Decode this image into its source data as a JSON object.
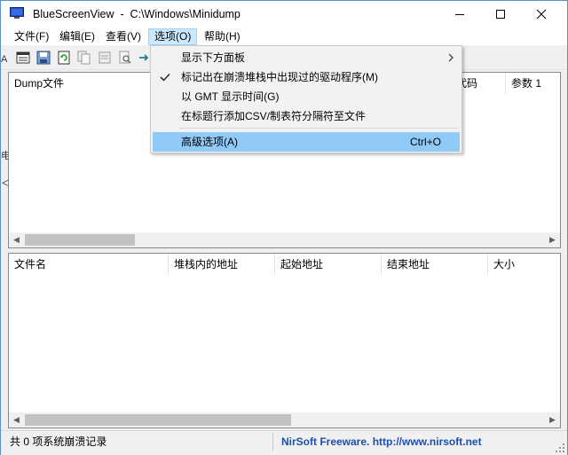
{
  "window": {
    "title": "BlueScreenView  -  C:\\Windows\\Minidump",
    "minimize_glyph": "─",
    "maximize_glyph": "☐",
    "close_glyph": "✕"
  },
  "menubar": {
    "items": [
      {
        "label": "文件(F)"
      },
      {
        "label": "编辑(E)"
      },
      {
        "label": "查看(V)"
      },
      {
        "label": "选项(O)"
      },
      {
        "label": "帮助(H)"
      }
    ]
  },
  "toolbar": {
    "icons": [
      "html-report-icon",
      "save-icon",
      "refresh-icon",
      "copy-icon",
      "properties-icon",
      "find-icon",
      "exit-icon"
    ]
  },
  "upper_list": {
    "columns": [
      {
        "label": "Dump文件"
      },
      {
        "label": "代码"
      },
      {
        "label": "参数 1"
      }
    ]
  },
  "lower_list": {
    "columns": [
      {
        "label": "文件名"
      },
      {
        "label": "堆栈内的地址"
      },
      {
        "label": "起始地址"
      },
      {
        "label": "结束地址"
      },
      {
        "label": "大小"
      }
    ]
  },
  "options_menu": {
    "items": [
      {
        "label": "显示下方面板",
        "has_submenu": true
      },
      {
        "label": "标记出在崩溃堆栈中出现过的驱动程序(M)",
        "checked": true
      },
      {
        "label": "以 GMT 显示时间(G)"
      },
      {
        "label": "在标题行添加CSV/制表符分隔符至文件"
      },
      {
        "label": "高级选项(A)",
        "shortcut": "Ctrl+O",
        "highlighted": true
      }
    ]
  },
  "statusbar": {
    "left": "共 0 项系统崩溃记录",
    "right": "NirSoft Freeware.  http://www.nirsoft.net"
  },
  "edge_glyphs": [
    "A",
    "电",
    "＜"
  ],
  "colors": {
    "accent": "#1c4fb0",
    "menu_highlight": "#91c9f7",
    "menu_active": "#cce8ff"
  }
}
